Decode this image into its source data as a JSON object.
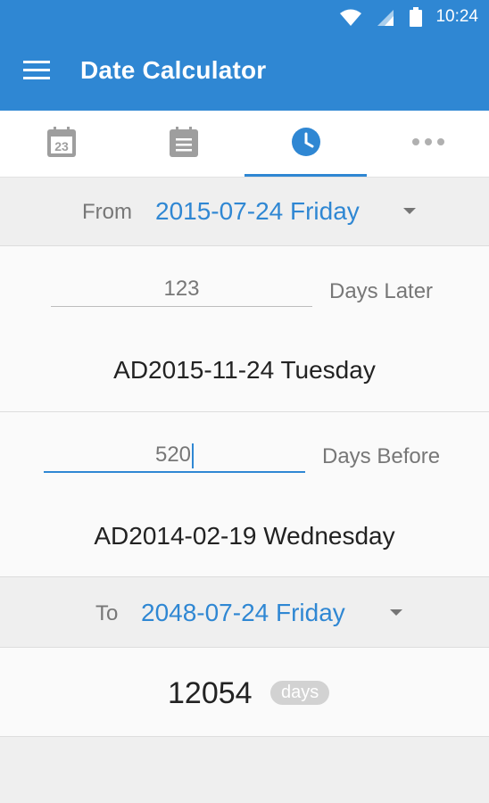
{
  "status_bar": {
    "time": "10:24"
  },
  "app_bar": {
    "title": "Date Calculator"
  },
  "tabs": [
    {
      "name": "calendar-23",
      "icon_text": "23"
    },
    {
      "name": "calendar-list"
    },
    {
      "name": "clock",
      "active": true
    },
    {
      "name": "more"
    }
  ],
  "from": {
    "label": "From",
    "date": "2015-07-24 Friday"
  },
  "later": {
    "days": "123",
    "unit_label": "Days Later",
    "result": "AD2015-11-24 Tuesday"
  },
  "before": {
    "days": "520",
    "unit_label": "Days Before",
    "result": "AD2014-02-19 Wednesday"
  },
  "to": {
    "label": "To",
    "date": "2048-07-24 Friday"
  },
  "difference": {
    "value": "12054",
    "unit": "days"
  },
  "colors": {
    "primary": "#2f87d3",
    "gray_text": "#777777",
    "badge": "#d2d2d2"
  }
}
